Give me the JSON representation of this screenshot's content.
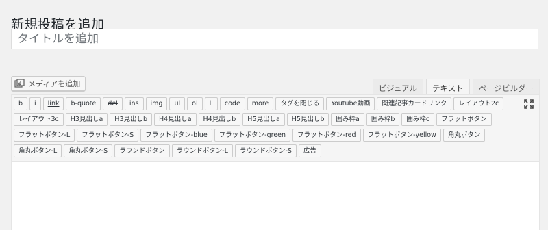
{
  "page": {
    "title": "新規投稿を追加"
  },
  "title_field": {
    "placeholder": "タイトルを追加",
    "value": ""
  },
  "media": {
    "label": "メディアを追加"
  },
  "editor_tabs": [
    {
      "label": "ビジュアル",
      "active": false
    },
    {
      "label": "テキスト",
      "active": true
    },
    {
      "label": "ページビルダー",
      "active": false
    }
  ],
  "quicktags": [
    {
      "label": "b",
      "style": ""
    },
    {
      "label": "i",
      "style": ""
    },
    {
      "label": "link",
      "style": "ul"
    },
    {
      "label": "b-quote",
      "style": ""
    },
    {
      "label": "del",
      "style": "strike"
    },
    {
      "label": "ins",
      "style": ""
    },
    {
      "label": "img",
      "style": ""
    },
    {
      "label": "ul",
      "style": ""
    },
    {
      "label": "ol",
      "style": ""
    },
    {
      "label": "li",
      "style": ""
    },
    {
      "label": "code",
      "style": ""
    },
    {
      "label": "more",
      "style": ""
    },
    {
      "label": "タグを閉じる",
      "style": ""
    },
    {
      "label": "Youtube動画",
      "style": ""
    },
    {
      "label": "関連記事カードリンク",
      "style": ""
    },
    {
      "label": "レイアウト2c",
      "style": ""
    },
    {
      "label": "レイアウト3c",
      "style": ""
    },
    {
      "label": "H3見出しa",
      "style": ""
    },
    {
      "label": "H3見出しb",
      "style": ""
    },
    {
      "label": "H4見出しa",
      "style": ""
    },
    {
      "label": "H4見出しb",
      "style": ""
    },
    {
      "label": "H5見出しa",
      "style": ""
    },
    {
      "label": "H5見出しb",
      "style": ""
    },
    {
      "label": "囲み枠a",
      "style": ""
    },
    {
      "label": "囲み枠b",
      "style": ""
    },
    {
      "label": "囲み枠c",
      "style": ""
    },
    {
      "label": "フラットボタン",
      "style": ""
    },
    {
      "label": "フラットボタン-L",
      "style": ""
    },
    {
      "label": "フラットボタン-S",
      "style": ""
    },
    {
      "label": "フラットボタン-blue",
      "style": ""
    },
    {
      "label": "フラットボタン-green",
      "style": ""
    },
    {
      "label": "フラットボタン-red",
      "style": ""
    },
    {
      "label": "フラットボタン-yellow",
      "style": ""
    },
    {
      "label": "角丸ボタン",
      "style": ""
    },
    {
      "label": "角丸ボタン-L",
      "style": ""
    },
    {
      "label": "角丸ボタン-S",
      "style": ""
    },
    {
      "label": "ラウンドボタン",
      "style": ""
    },
    {
      "label": "ラウンドボタン-L",
      "style": ""
    },
    {
      "label": "ラウンドボタン-S",
      "style": ""
    },
    {
      "label": "広告",
      "style": ""
    }
  ],
  "icons": {
    "media": "media-icon",
    "fullscreen": "fullscreen-expand-icon"
  }
}
